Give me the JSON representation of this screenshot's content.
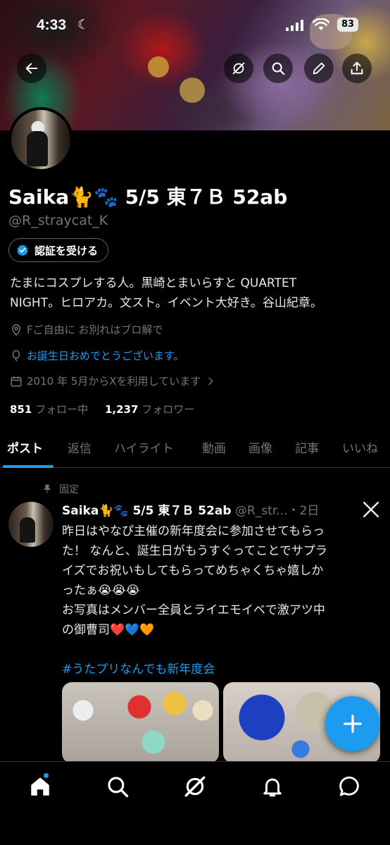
{
  "status_bar": {
    "time": "4:33",
    "battery": "83"
  },
  "profile": {
    "name": "Saika🐈🐾 5/5 東７Ｂ 52ab",
    "handle": "@R_straycat_K",
    "verify_label": "認証を受ける",
    "bio_line1": "たまにコスプレする人。黒崎とまいらすと QUARTET",
    "bio_line2": "NIGHT。ヒロアカ。文スト。イベント大好き。谷山紀章。",
    "location": "Fご自由に お別れはブロ解で",
    "birthday": "お誕生日おめでとうございます。",
    "joined": "2010 年 5月からXを利用しています",
    "following_count": "851",
    "following_label": "フォロー中",
    "followers_count": "1,237",
    "followers_label": "フォロワー"
  },
  "tabs": [
    "ポスト",
    "返信",
    "ハイライト",
    "動画",
    "画像",
    "記事",
    "いいね"
  ],
  "post": {
    "pinned_label": "固定",
    "author": "Saika🐈🐾 5/5 東７Ｂ 52ab",
    "handle_time": "@R_str...・2日",
    "body_line1": "昨日はやなぴ主催の新年度会に参加させてもらっ",
    "body_line2": "た！ なんと、誕生日がもうすぐってことでサプラ",
    "body_line3": "イズでお祝いもしてもらってめちゃくちゃ嬉しか",
    "body_line4": "ったぁ😭😭😭",
    "body_line5": "お写真はメンバー全員とライエモイベで激アツ中",
    "body_line6": "の御曹司❤️💙🧡",
    "hashtag": "#うたプリなんでも新年度会"
  },
  "colors": {
    "accent": "#1d9bf0",
    "background": "#000000",
    "muted": "#71767b"
  },
  "icons": {
    "top": [
      "back-arrow-icon",
      "grok-icon",
      "search-icon",
      "edit-icon",
      "share-icon"
    ],
    "bottom_nav": [
      "home-icon",
      "search-icon",
      "grok-icon",
      "bell-icon",
      "messages-icon"
    ]
  }
}
